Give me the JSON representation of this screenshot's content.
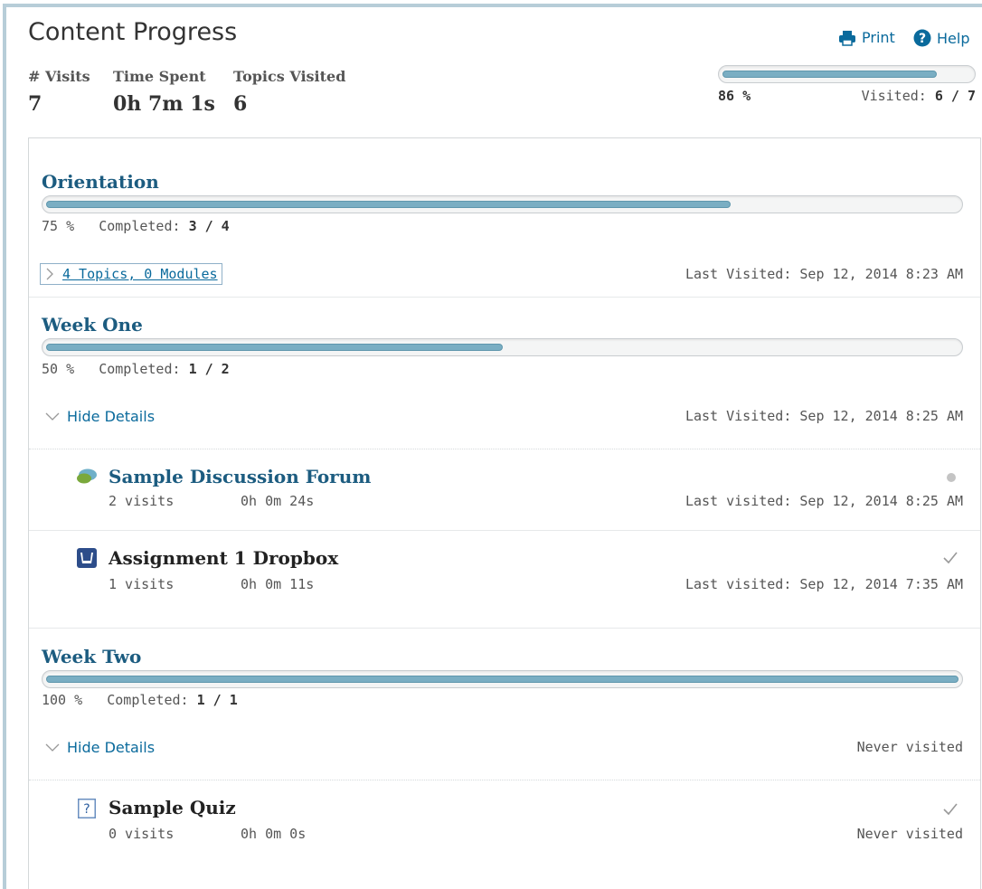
{
  "header": {
    "title": "Content Progress",
    "print_label": "Print",
    "help_label": "Help",
    "visits_label": "# Visits",
    "visits_value": "7",
    "time_label": "Time Spent",
    "time_value": "0h 7m 1s",
    "topics_label": "Topics Visited",
    "topics_value": "6",
    "overall_percent_label": "86 %",
    "overall_progress": 0.86,
    "visited_label": "Visited:",
    "visited_value": "6 / 7"
  },
  "sections": [
    {
      "title": "Orientation",
      "progress": 0.75,
      "percent_label": "75 %",
      "completed_label": "Completed:",
      "completed_value": "3 / 4",
      "toggle_label": "4 Topics, 0 Modules",
      "last_visited": "Last Visited: Sep 12, 2014 8:23 AM"
    },
    {
      "title": "Week One",
      "progress": 0.5,
      "percent_label": "50 %",
      "completed_label": "Completed:",
      "completed_value": "1 / 2",
      "toggle_label": "Hide Details",
      "last_visited": "Last Visited: Sep 12, 2014 8:25 AM",
      "items": [
        {
          "title": "Sample Discussion Forum",
          "icon": "discussion-icon",
          "visits": "2 visits",
          "time": "0h 0m 24s",
          "last_visited": "Last visited: Sep 12, 2014 8:25 AM",
          "status": "in-progress"
        },
        {
          "title": "Assignment 1 Dropbox",
          "icon": "dropbox-icon",
          "visits": "1 visits",
          "time": "0h 0m 11s",
          "last_visited": "Last visited: Sep 12, 2014 7:35 AM",
          "status": "complete"
        }
      ]
    },
    {
      "title": "Week Two",
      "progress": 1.0,
      "percent_label": "100 %",
      "completed_label": "Completed:",
      "completed_value": "1 / 1",
      "toggle_label": "Hide Details",
      "last_visited": "Never visited",
      "items": [
        {
          "title": "Sample Quiz",
          "icon": "quiz-icon",
          "visits": "0 visits",
          "time": "0h 0m 0s",
          "last_visited": "Never visited",
          "status": "complete"
        }
      ]
    }
  ],
  "colors": {
    "accent": "#0a6a9c",
    "bar_fill": "#7aaec3",
    "section_title": "#1c5c80"
  }
}
